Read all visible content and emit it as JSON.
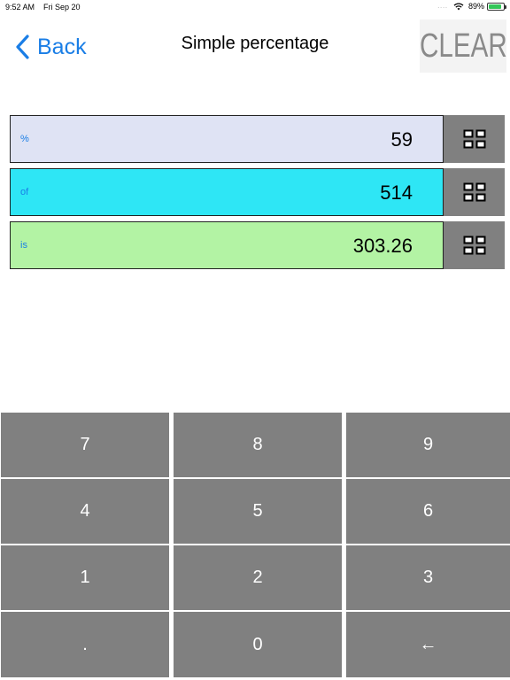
{
  "status_bar": {
    "time": "9:52 AM",
    "date": "Fri Sep 20",
    "signal_dots": "....",
    "battery_percent": "89%",
    "battery_level": 0.89
  },
  "nav": {
    "back_label": "Back",
    "title": "Simple percentage",
    "clear_label": "CLEAR"
  },
  "fields": [
    {
      "label": "%",
      "value": "59",
      "color": "#dfe3f4"
    },
    {
      "label": "of",
      "value": "514",
      "color": "#2ee6f5"
    },
    {
      "label": "is",
      "value": "303.26",
      "color": "#b3f3a4"
    }
  ],
  "keypad": {
    "keys": [
      "7",
      "8",
      "9",
      "4",
      "5",
      "6",
      "1",
      "2",
      "3",
      ".",
      "0",
      "←"
    ]
  },
  "colors": {
    "accent": "#1a7ee6",
    "key_bg": "#808080",
    "key_text": "#ffffff"
  }
}
